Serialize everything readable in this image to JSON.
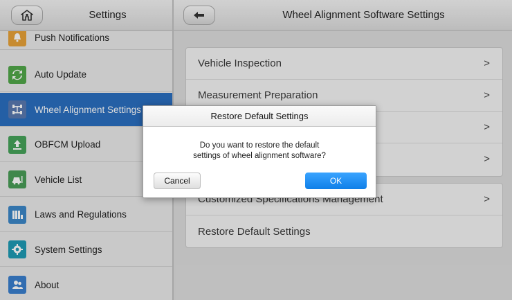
{
  "sidebar": {
    "title": "Settings",
    "items": [
      {
        "label": "Push Notifications",
        "icon": "bell-icon",
        "color": "#e8a238"
      },
      {
        "label": "Auto Update",
        "icon": "sync-icon",
        "color": "#52a84a"
      },
      {
        "label": "Wheel Alignment Settings",
        "icon": "wheel-alignment-icon",
        "color": "#5a7ab0",
        "active": true
      },
      {
        "label": "OBFCM Upload",
        "icon": "upload-icon",
        "color": "#46a35a"
      },
      {
        "label": "Vehicle List",
        "icon": "car-icon",
        "color": "#4a9e58"
      },
      {
        "label": "Laws and Regulations",
        "icon": "books-icon",
        "color": "#3c88c9"
      },
      {
        "label": "System Settings",
        "icon": "gear-icon",
        "color": "#1f9bb5"
      },
      {
        "label": "About",
        "icon": "people-icon",
        "color": "#3a7fcf"
      }
    ]
  },
  "header": {
    "title": "Wheel Alignment Software Settings"
  },
  "main": {
    "group1": [
      {
        "label": "Vehicle Inspection",
        "chevron": ">"
      },
      {
        "label": "Measurement Preparation",
        "chevron": ">"
      },
      {
        "label": "",
        "chevron": ">"
      },
      {
        "label": "",
        "chevron": ">"
      }
    ],
    "group2": [
      {
        "label": "Customized Specifications Management",
        "chevron": ">"
      },
      {
        "label": "Restore Default Settings",
        "chevron": ""
      }
    ]
  },
  "dialog": {
    "title": "Restore Default Settings",
    "message_line1": "Do you want to restore the default",
    "message_line2": "settings of wheel alignment software?",
    "cancel_label": "Cancel",
    "ok_label": "OK"
  },
  "colors": {
    "active_item": "#2b6fc1",
    "ok_button": "#1a8cf0"
  }
}
